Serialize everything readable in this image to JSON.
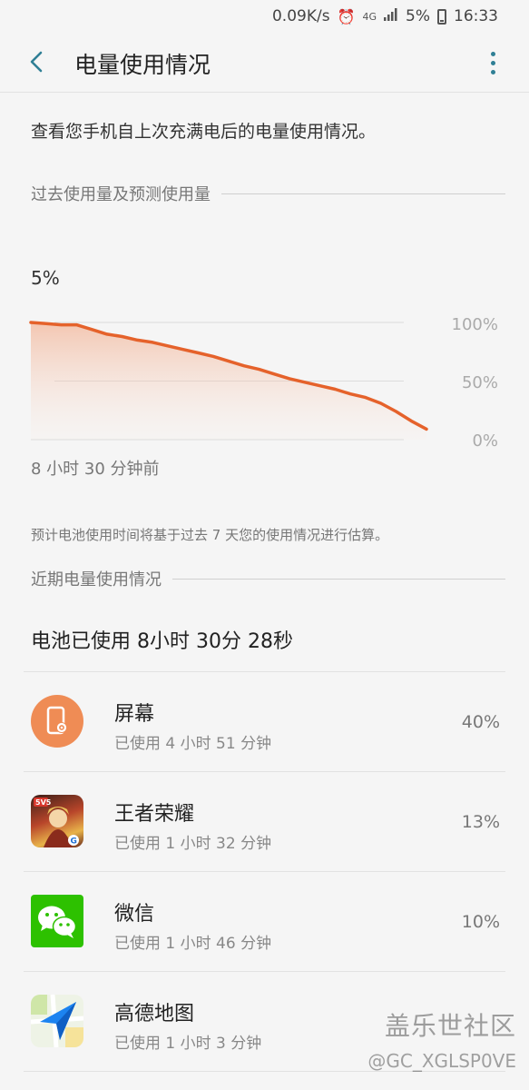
{
  "status_bar": {
    "net_speed": "0.09K/s",
    "network": "4G",
    "battery_pct": "5%",
    "time": "16:33"
  },
  "header": {
    "title": "电量使用情况"
  },
  "description": "查看您手机自上次充满电后的电量使用情况。",
  "past_section": {
    "title": "过去使用量及预测使用量"
  },
  "chart_data": {
    "type": "area",
    "current_label": "5%",
    "y_tick_labels": [
      "100%",
      "50%",
      "0%"
    ],
    "ylim": [
      0,
      100
    ],
    "x_start_label": "8 小时 30 分钟前",
    "series": [
      {
        "values": [
          100,
          99,
          98,
          98,
          94,
          90,
          88,
          85,
          83,
          80,
          77,
          74,
          71,
          67,
          63,
          60,
          56,
          52,
          49,
          46,
          43,
          39,
          36,
          31,
          24,
          16,
          9
        ],
        "color": "#e5622b"
      }
    ]
  },
  "estimate_note": "预计电池使用时间将基于过去 7 天您的使用情况进行估算。",
  "recent_section": {
    "title": "近期电量使用情况"
  },
  "total_usage": "电池已使用 8小时 30分 28秒",
  "apps": [
    {
      "name": "屏幕",
      "usage": "已使用 4 小时 51 分钟",
      "percent": "40%",
      "icon": "screen-icon"
    },
    {
      "name": "王者荣耀",
      "usage": "已使用 1 小时 32 分钟",
      "percent": "13%",
      "icon": "game-icon"
    },
    {
      "name": "微信",
      "usage": "已使用 1 小时 46 分钟",
      "percent": "10%",
      "icon": "wechat-icon"
    },
    {
      "name": "高德地图",
      "usage": "已使用 1 小时 3 分钟",
      "percent": "",
      "icon": "map-icon"
    }
  ],
  "watermark": {
    "line1": "盖乐世社区",
    "line2": "@GC_XGLSP0VE"
  },
  "colors": {
    "accent": "#2f7f95",
    "chart_line": "#e5622b",
    "screen_icon_bg": "#ef8c55",
    "wechat_bg": "#2dc100"
  }
}
